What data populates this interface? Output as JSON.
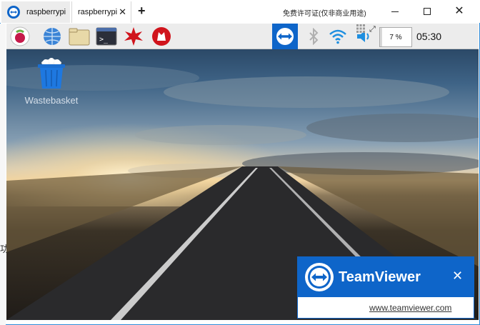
{
  "tabs": [
    {
      "label": "raspberrypi"
    },
    {
      "label": "raspberrypi",
      "close": "✕"
    }
  ],
  "new_tab": "+",
  "license_notice": "免费许可证(仅非商业用途)",
  "window_buttons": {
    "minimize": "minimize",
    "maximize": "maximize",
    "close": "✕"
  },
  "left_edge_glyph": "功",
  "taskbar": {
    "icons": [
      "raspberry-menu",
      "web-browser",
      "file-manager",
      "terminal",
      "mathematica",
      "wolfram"
    ],
    "tray": {
      "teamviewer": "teamviewer",
      "bluetooth": "bluetooth",
      "wifi": "wifi",
      "volume": "volume",
      "cpu_percent": 7,
      "cpu_text": "7 %",
      "expand": "⤢",
      "chevron": "⌄",
      "clock": "05:30"
    }
  },
  "desktop": {
    "icon_label": "Wastebasket"
  },
  "teamviewer_popup": {
    "brand": "TeamViewer",
    "close": "✕",
    "link": "www.teamviewer.com"
  },
  "colors": {
    "teamviewer_blue": "#0e65c9",
    "frame_blue": "#2d8ad7",
    "taskbar_bg": "#ececec"
  }
}
